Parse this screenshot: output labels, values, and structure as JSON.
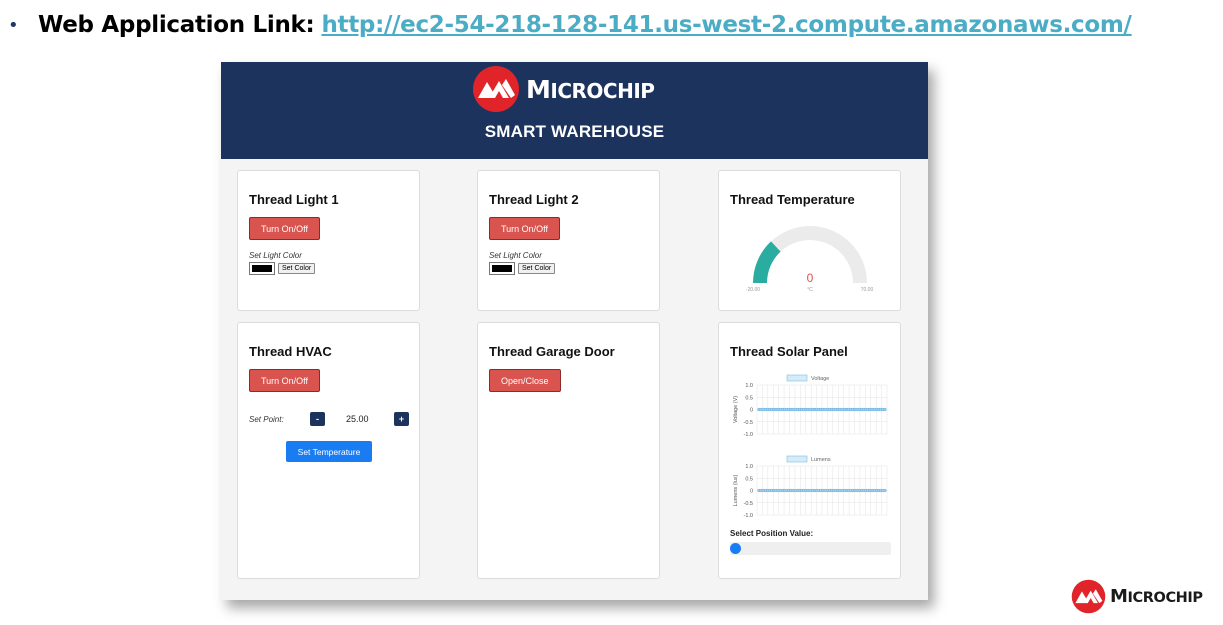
{
  "slide": {
    "bullet": "•",
    "label": "Web Application Link:",
    "url": "http://ec2-54-218-128-141.us-west-2.compute.amazonaws.com/"
  },
  "app": {
    "brand_first": "M",
    "brand_rest": "ICROCHIP",
    "title": "SMART WAREHOUSE",
    "cards": {
      "light1": {
        "title": "Thread Light 1",
        "button": "Turn On/Off",
        "color_label": "Set Light Color",
        "set_color": "Set Color",
        "swatch_color": "#000000"
      },
      "light2": {
        "title": "Thread Light 2",
        "button": "Turn On/Off",
        "color_label": "Set Light Color",
        "set_color": "Set Color",
        "swatch_color": "#000000"
      },
      "temperature": {
        "title": "Thread Temperature",
        "value": "0",
        "unit": "°C",
        "min": "-20.00",
        "max": "70.00"
      },
      "hvac": {
        "title": "Thread HVAC",
        "button": "Turn On/Off",
        "setpoint_label": "Set Point:",
        "minus": "-",
        "plus": "+",
        "setpoint_value": "25.00",
        "set_button": "Set Temperature"
      },
      "garage": {
        "title": "Thread Garage Door",
        "button": "Open/Close"
      },
      "solar": {
        "title": "Thread Solar Panel",
        "position_label": "Select Position Value:",
        "slider_value": 0
      }
    }
  },
  "chart_data": [
    {
      "type": "line",
      "series": [
        {
          "name": "Voltage",
          "values": [
            0,
            0,
            0,
            0,
            0,
            0,
            0,
            0,
            0,
            0,
            0,
            0,
            0,
            0,
            0,
            0,
            0,
            0,
            0,
            0,
            0,
            0,
            0,
            0,
            0,
            0,
            0,
            0,
            0,
            0,
            0,
            0,
            0,
            0,
            0,
            0,
            0,
            0,
            0,
            0,
            0,
            0,
            0,
            0,
            0,
            0,
            0,
            0,
            0,
            0,
            0,
            0,
            0,
            0,
            0,
            0,
            0,
            0,
            0,
            0
          ]
        }
      ],
      "ylabel": "Voltage (V)",
      "ylim": [
        -1.0,
        1.0
      ],
      "yticks": [
        "1.0",
        "0.5",
        "0",
        "-0.5",
        "-1.0"
      ],
      "grid": true,
      "legend": "top-center"
    },
    {
      "type": "line",
      "series": [
        {
          "name": "Lumens",
          "values": [
            0,
            0,
            0,
            0,
            0,
            0,
            0,
            0,
            0,
            0,
            0,
            0,
            0,
            0,
            0,
            0,
            0,
            0,
            0,
            0,
            0,
            0,
            0,
            0,
            0,
            0,
            0,
            0,
            0,
            0,
            0,
            0,
            0,
            0,
            0,
            0,
            0,
            0,
            0,
            0,
            0,
            0,
            0,
            0,
            0,
            0,
            0,
            0,
            0,
            0,
            0,
            0,
            0,
            0,
            0,
            0,
            0,
            0,
            0,
            0
          ]
        }
      ],
      "ylabel": "Lumens (lux)",
      "ylim": [
        -1.0,
        1.0
      ],
      "yticks": [
        "1.0",
        "0.5",
        "0",
        "-0.5",
        "-1.0"
      ],
      "grid": true,
      "legend": "top-center"
    }
  ],
  "colors": {
    "header_bg": "#1c335e",
    "red_button": "#d9534f",
    "blue_button": "#1a7cf3",
    "gauge_fill": "#2aaca1",
    "gauge_value": "#d9534f",
    "series_line": "#5aa9dc",
    "url": "#4bacc6"
  },
  "corner_logo": {
    "first": "M",
    "rest": "ICROCHIP"
  }
}
